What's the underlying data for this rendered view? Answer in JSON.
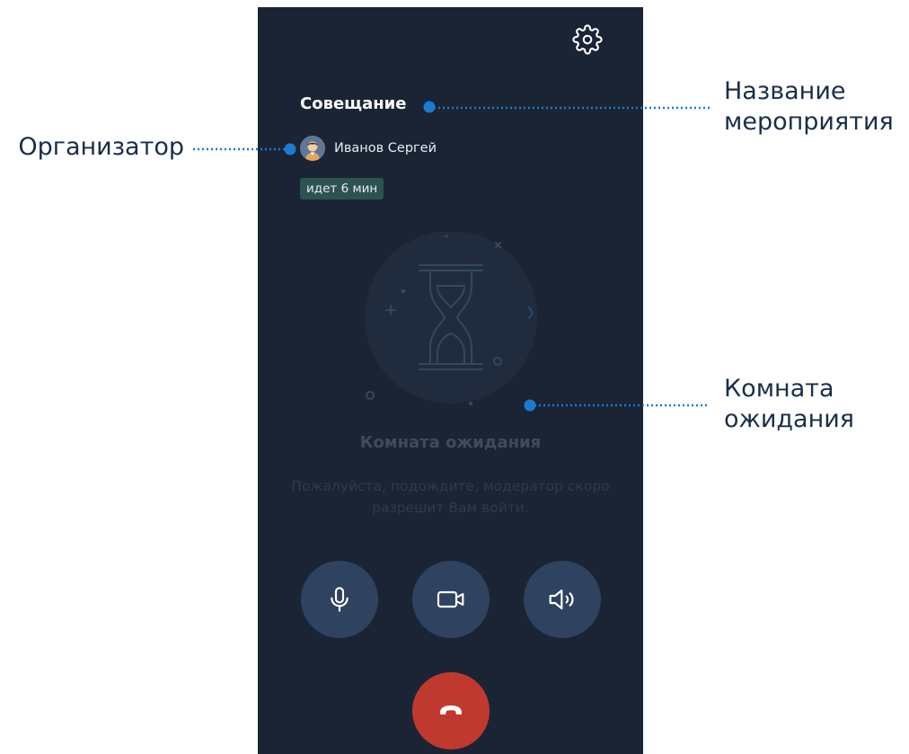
{
  "app": {
    "meeting_title": "Совещание",
    "organizer_name": "Иванов Сергей",
    "duration_badge": "идет 6 мин",
    "waiting_room": {
      "title": "Комната ожидания",
      "message": "Пожалуйста, подождите, модератор скоро разрешит Вам войти."
    },
    "controls": {
      "settings_icon": "gear-icon",
      "mic_icon": "microphone-icon",
      "camera_icon": "video-camera-icon",
      "speaker_icon": "speaker-icon",
      "hangup_icon": "phone-hangup-icon"
    }
  },
  "annotations": {
    "event_name": "Название мероприятия",
    "organizer": "Организатор",
    "waiting_room": "Комната ожидания"
  },
  "colors": {
    "screen_bg": "#1b2434",
    "control_bg": "#2f425f",
    "hangup": "#c0392f",
    "badge_bg": "#2d5252",
    "callout_blue": "#1a7bd0",
    "annotation_text": "#1a2e4a"
  }
}
